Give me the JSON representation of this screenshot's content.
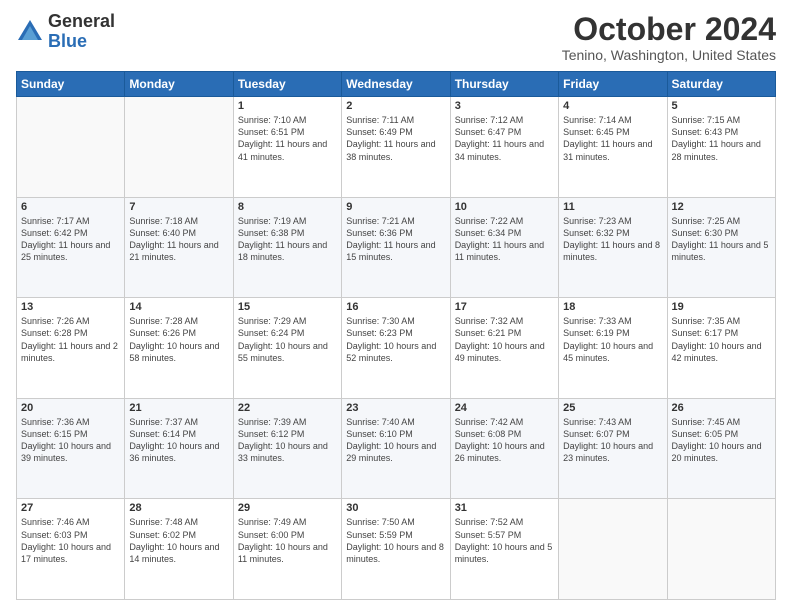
{
  "header": {
    "logo_general": "General",
    "logo_blue": "Blue",
    "month_title": "October 2024",
    "location": "Tenino, Washington, United States"
  },
  "weekdays": [
    "Sunday",
    "Monday",
    "Tuesday",
    "Wednesday",
    "Thursday",
    "Friday",
    "Saturday"
  ],
  "weeks": [
    [
      {
        "day": "",
        "content": ""
      },
      {
        "day": "",
        "content": ""
      },
      {
        "day": "1",
        "content": "Sunrise: 7:10 AM\nSunset: 6:51 PM\nDaylight: 11 hours and 41 minutes."
      },
      {
        "day": "2",
        "content": "Sunrise: 7:11 AM\nSunset: 6:49 PM\nDaylight: 11 hours and 38 minutes."
      },
      {
        "day": "3",
        "content": "Sunrise: 7:12 AM\nSunset: 6:47 PM\nDaylight: 11 hours and 34 minutes."
      },
      {
        "day": "4",
        "content": "Sunrise: 7:14 AM\nSunset: 6:45 PM\nDaylight: 11 hours and 31 minutes."
      },
      {
        "day": "5",
        "content": "Sunrise: 7:15 AM\nSunset: 6:43 PM\nDaylight: 11 hours and 28 minutes."
      }
    ],
    [
      {
        "day": "6",
        "content": "Sunrise: 7:17 AM\nSunset: 6:42 PM\nDaylight: 11 hours and 25 minutes."
      },
      {
        "day": "7",
        "content": "Sunrise: 7:18 AM\nSunset: 6:40 PM\nDaylight: 11 hours and 21 minutes."
      },
      {
        "day": "8",
        "content": "Sunrise: 7:19 AM\nSunset: 6:38 PM\nDaylight: 11 hours and 18 minutes."
      },
      {
        "day": "9",
        "content": "Sunrise: 7:21 AM\nSunset: 6:36 PM\nDaylight: 11 hours and 15 minutes."
      },
      {
        "day": "10",
        "content": "Sunrise: 7:22 AM\nSunset: 6:34 PM\nDaylight: 11 hours and 11 minutes."
      },
      {
        "day": "11",
        "content": "Sunrise: 7:23 AM\nSunset: 6:32 PM\nDaylight: 11 hours and 8 minutes."
      },
      {
        "day": "12",
        "content": "Sunrise: 7:25 AM\nSunset: 6:30 PM\nDaylight: 11 hours and 5 minutes."
      }
    ],
    [
      {
        "day": "13",
        "content": "Sunrise: 7:26 AM\nSunset: 6:28 PM\nDaylight: 11 hours and 2 minutes."
      },
      {
        "day": "14",
        "content": "Sunrise: 7:28 AM\nSunset: 6:26 PM\nDaylight: 10 hours and 58 minutes."
      },
      {
        "day": "15",
        "content": "Sunrise: 7:29 AM\nSunset: 6:24 PM\nDaylight: 10 hours and 55 minutes."
      },
      {
        "day": "16",
        "content": "Sunrise: 7:30 AM\nSunset: 6:23 PM\nDaylight: 10 hours and 52 minutes."
      },
      {
        "day": "17",
        "content": "Sunrise: 7:32 AM\nSunset: 6:21 PM\nDaylight: 10 hours and 49 minutes."
      },
      {
        "day": "18",
        "content": "Sunrise: 7:33 AM\nSunset: 6:19 PM\nDaylight: 10 hours and 45 minutes."
      },
      {
        "day": "19",
        "content": "Sunrise: 7:35 AM\nSunset: 6:17 PM\nDaylight: 10 hours and 42 minutes."
      }
    ],
    [
      {
        "day": "20",
        "content": "Sunrise: 7:36 AM\nSunset: 6:15 PM\nDaylight: 10 hours and 39 minutes."
      },
      {
        "day": "21",
        "content": "Sunrise: 7:37 AM\nSunset: 6:14 PM\nDaylight: 10 hours and 36 minutes."
      },
      {
        "day": "22",
        "content": "Sunrise: 7:39 AM\nSunset: 6:12 PM\nDaylight: 10 hours and 33 minutes."
      },
      {
        "day": "23",
        "content": "Sunrise: 7:40 AM\nSunset: 6:10 PM\nDaylight: 10 hours and 29 minutes."
      },
      {
        "day": "24",
        "content": "Sunrise: 7:42 AM\nSunset: 6:08 PM\nDaylight: 10 hours and 26 minutes."
      },
      {
        "day": "25",
        "content": "Sunrise: 7:43 AM\nSunset: 6:07 PM\nDaylight: 10 hours and 23 minutes."
      },
      {
        "day": "26",
        "content": "Sunrise: 7:45 AM\nSunset: 6:05 PM\nDaylight: 10 hours and 20 minutes."
      }
    ],
    [
      {
        "day": "27",
        "content": "Sunrise: 7:46 AM\nSunset: 6:03 PM\nDaylight: 10 hours and 17 minutes."
      },
      {
        "day": "28",
        "content": "Sunrise: 7:48 AM\nSunset: 6:02 PM\nDaylight: 10 hours and 14 minutes."
      },
      {
        "day": "29",
        "content": "Sunrise: 7:49 AM\nSunset: 6:00 PM\nDaylight: 10 hours and 11 minutes."
      },
      {
        "day": "30",
        "content": "Sunrise: 7:50 AM\nSunset: 5:59 PM\nDaylight: 10 hours and 8 minutes."
      },
      {
        "day": "31",
        "content": "Sunrise: 7:52 AM\nSunset: 5:57 PM\nDaylight: 10 hours and 5 minutes."
      },
      {
        "day": "",
        "content": ""
      },
      {
        "day": "",
        "content": ""
      }
    ]
  ]
}
